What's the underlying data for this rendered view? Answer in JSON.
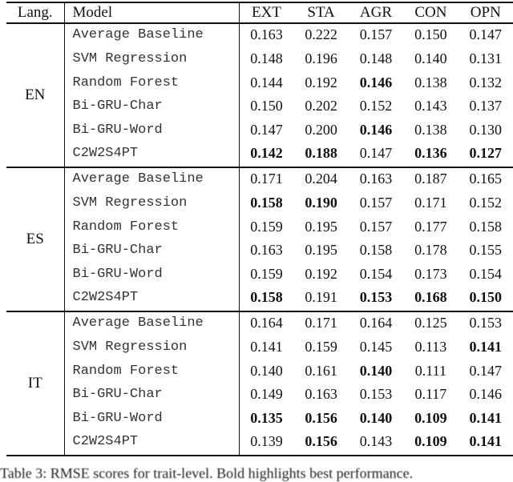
{
  "table": {
    "headers": {
      "lang": "Lang.",
      "model": "Model",
      "metrics": [
        "EXT",
        "STA",
        "AGR",
        "CON",
        "OPN"
      ]
    },
    "groups": [
      {
        "lang": "EN",
        "rows": [
          {
            "model": "Average Baseline",
            "values": [
              "0.163",
              "0.222",
              "0.157",
              "0.150",
              "0.147"
            ],
            "bold": [
              false,
              false,
              false,
              false,
              false
            ]
          },
          {
            "model": "SVM Regression",
            "values": [
              "0.148",
              "0.196",
              "0.148",
              "0.140",
              "0.131"
            ],
            "bold": [
              false,
              false,
              false,
              false,
              false
            ]
          },
          {
            "model": "Random Forest",
            "values": [
              "0.144",
              "0.192",
              "0.146",
              "0.138",
              "0.132"
            ],
            "bold": [
              false,
              false,
              true,
              false,
              false
            ]
          },
          {
            "model": "Bi-GRU-Char",
            "values": [
              "0.150",
              "0.202",
              "0.152",
              "0.143",
              "0.137"
            ],
            "bold": [
              false,
              false,
              false,
              false,
              false
            ]
          },
          {
            "model": "Bi-GRU-Word",
            "values": [
              "0.147",
              "0.200",
              "0.146",
              "0.138",
              "0.130"
            ],
            "bold": [
              false,
              false,
              true,
              false,
              false
            ]
          },
          {
            "model": "C2W2S4PT",
            "values": [
              "0.142",
              "0.188",
              "0.147",
              "0.136",
              "0.127"
            ],
            "bold": [
              true,
              true,
              false,
              true,
              true
            ]
          }
        ]
      },
      {
        "lang": "ES",
        "rows": [
          {
            "model": "Average Baseline",
            "values": [
              "0.171",
              "0.204",
              "0.163",
              "0.187",
              "0.165"
            ],
            "bold": [
              false,
              false,
              false,
              false,
              false
            ]
          },
          {
            "model": "SVM Regression",
            "values": [
              "0.158",
              "0.190",
              "0.157",
              "0.171",
              "0.152"
            ],
            "bold": [
              true,
              true,
              false,
              false,
              false
            ]
          },
          {
            "model": "Random Forest",
            "values": [
              "0.159",
              "0.195",
              "0.157",
              "0.177",
              "0.158"
            ],
            "bold": [
              false,
              false,
              false,
              false,
              false
            ]
          },
          {
            "model": "Bi-GRU-Char",
            "values": [
              "0.163",
              "0.195",
              "0.158",
              "0.178",
              "0.155"
            ],
            "bold": [
              false,
              false,
              false,
              false,
              false
            ]
          },
          {
            "model": "Bi-GRU-Word",
            "values": [
              "0.159",
              "0.192",
              "0.154",
              "0.173",
              "0.154"
            ],
            "bold": [
              false,
              false,
              false,
              false,
              false
            ]
          },
          {
            "model": "C2W2S4PT",
            "values": [
              "0.158",
              "0.191",
              "0.153",
              "0.168",
              "0.150"
            ],
            "bold": [
              true,
              false,
              true,
              true,
              true
            ]
          }
        ]
      },
      {
        "lang": "IT",
        "rows": [
          {
            "model": "Average Baseline",
            "values": [
              "0.164",
              "0.171",
              "0.164",
              "0.125",
              "0.153"
            ],
            "bold": [
              false,
              false,
              false,
              false,
              false
            ]
          },
          {
            "model": "SVM Regression",
            "values": [
              "0.141",
              "0.159",
              "0.145",
              "0.113",
              "0.141"
            ],
            "bold": [
              false,
              false,
              false,
              false,
              true
            ]
          },
          {
            "model": "Random Forest",
            "values": [
              "0.140",
              "0.161",
              "0.140",
              "0.111",
              "0.147"
            ],
            "bold": [
              false,
              false,
              true,
              false,
              false
            ]
          },
          {
            "model": "Bi-GRU-Char",
            "values": [
              "0.149",
              "0.163",
              "0.153",
              "0.117",
              "0.146"
            ],
            "bold": [
              false,
              false,
              false,
              false,
              false
            ]
          },
          {
            "model": "Bi-GRU-Word",
            "values": [
              "0.135",
              "0.156",
              "0.140",
              "0.109",
              "0.141"
            ],
            "bold": [
              true,
              true,
              true,
              true,
              true
            ]
          },
          {
            "model": "C2W2S4PT",
            "values": [
              "0.139",
              "0.156",
              "0.143",
              "0.109",
              "0.141"
            ],
            "bold": [
              false,
              true,
              false,
              true,
              true
            ]
          }
        ]
      }
    ]
  },
  "caption": "Table 3: RMSE scores for trait-level. Bold highlights best performance."
}
